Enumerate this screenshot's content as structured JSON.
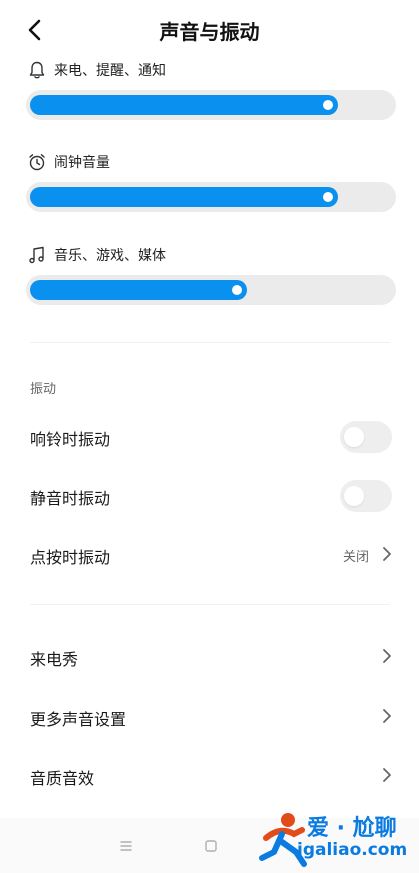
{
  "header": {
    "title": "声音与振动"
  },
  "volumes": [
    {
      "label": "来电、提醒、通知",
      "icon": "bell-icon",
      "level_percent": 85
    },
    {
      "label": "闹钟音量",
      "icon": "alarm-clock-icon",
      "level_percent": 85
    },
    {
      "label": "音乐、游戏、媒体",
      "icon": "music-note-icon",
      "level_percent": 60
    }
  ],
  "vibration": {
    "section_title": "振动",
    "ring_vibrate": {
      "label": "响铃时振动",
      "enabled": false
    },
    "silent_vibrate": {
      "label": "静音时振动",
      "enabled": false
    },
    "touch_vibrate": {
      "label": "点按时振动",
      "value": "关闭"
    }
  },
  "more": {
    "caller_show": "来电秀",
    "more_sound": "更多声音设置",
    "audio_quality": "音质音效"
  },
  "watermark": {
    "cn": "爱 · 尬聊",
    "en": "igaliao.com"
  },
  "colors": {
    "accent": "#0a90ee",
    "track": "#ebebeb",
    "toggle_off": "#eeeeee",
    "watermark": "#0a7be0"
  }
}
